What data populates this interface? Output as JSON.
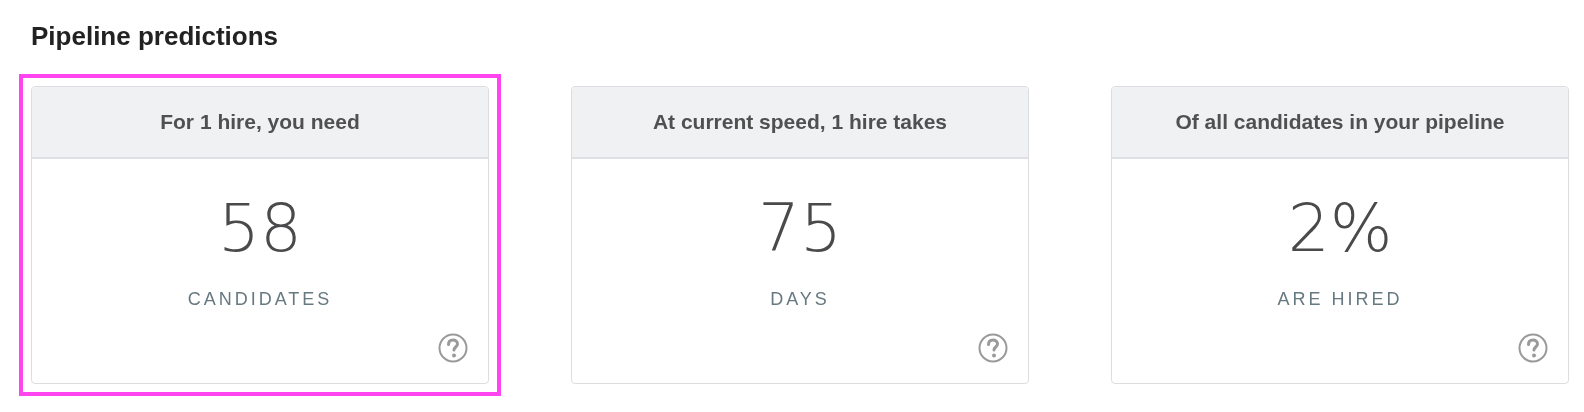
{
  "section_title": "Pipeline predictions",
  "cards": [
    {
      "header": "For 1 hire, you need",
      "value": "58",
      "unit": "CANDIDATES",
      "selected": true
    },
    {
      "header": "At current speed, 1 hire takes",
      "value": "75",
      "unit": "DAYS",
      "selected": false
    },
    {
      "header": "Of all candidates in your pipeline",
      "value": "2%",
      "unit": "ARE HIRED",
      "selected": false
    }
  ]
}
